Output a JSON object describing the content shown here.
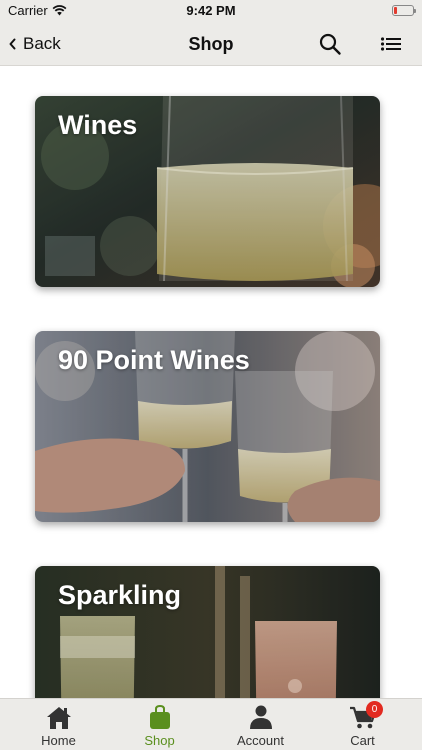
{
  "status_bar": {
    "carrier": "Carrier",
    "time": "9:42 PM",
    "battery_color": "#e23a2e"
  },
  "nav": {
    "back_label": "Back",
    "title": "Shop",
    "search_icon": "search-icon",
    "menu_icon": "list-menu-icon"
  },
  "categories": [
    {
      "title": "Wines"
    },
    {
      "title": "90 Point Wines"
    },
    {
      "title": "Sparkling"
    }
  ],
  "tabs": [
    {
      "label": "Home",
      "icon": "home-icon",
      "active": false
    },
    {
      "label": "Shop",
      "icon": "shopping-bag-icon",
      "active": true
    },
    {
      "label": "Account",
      "icon": "person-icon",
      "active": false
    },
    {
      "label": "Cart",
      "icon": "cart-icon",
      "active": false,
      "badge": "0"
    }
  ],
  "colors": {
    "bar_background": "#ecebe8",
    "active_tab": "#5a8f1e",
    "badge": "#e22a20"
  }
}
